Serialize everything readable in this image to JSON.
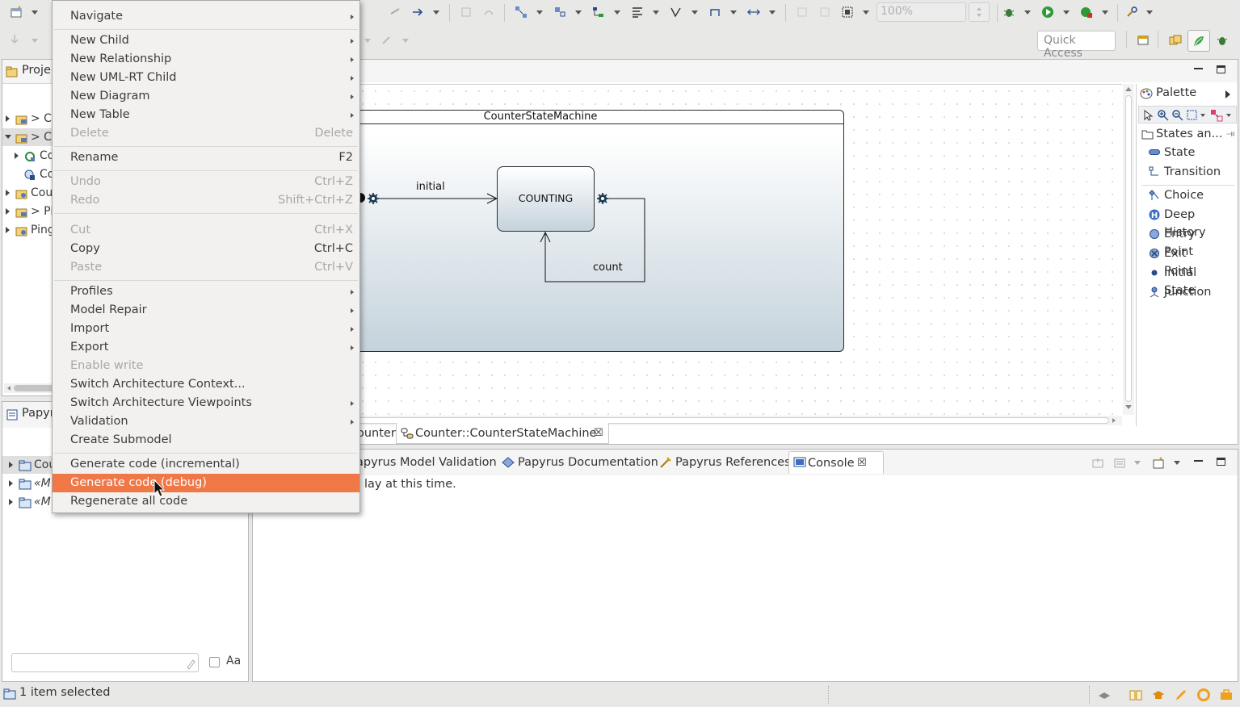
{
  "toolbar": {
    "zoom_value": "100%",
    "quick_access_placeholder": "Quick Access"
  },
  "project_explorer": {
    "title": "Projec",
    "rows": [
      {
        "label": "> Co",
        "expanded": false
      },
      {
        "label": "> Co",
        "expanded": true
      },
      {
        "label": "Co",
        "expanded": false
      },
      {
        "label": "Co",
        "expanded": false
      },
      {
        "label": "Cou",
        "expanded": false
      },
      {
        "label": "> Pi",
        "expanded": false
      },
      {
        "label": "Ping",
        "expanded": false
      }
    ]
  },
  "model_explorer": {
    "title": "Papyru",
    "rows": [
      {
        "label": "Cou"
      },
      {
        "label": "«M"
      },
      {
        "label": "«M"
      }
    ],
    "filter_placeholder": "",
    "case_label": "Aa"
  },
  "diagram": {
    "state_machine_label": "CounterStateMachine",
    "state_label": "COUNTING",
    "initial_transition_label": "initial",
    "loop_transition_label": "count"
  },
  "editor_tabs": [
    {
      "label": "ounter"
    },
    {
      "label": "Counter::CounterStateMachine"
    }
  ],
  "palette": {
    "title": "Palette",
    "drawer_label": "States an...",
    "items": [
      {
        "label": "State",
        "icon": "state-icon"
      },
      {
        "label": "Transition",
        "icon": "transition-icon"
      },
      {
        "label": "Choice",
        "icon": "choice-icon"
      },
      {
        "label": "Deep History",
        "icon": "deep-history-icon"
      },
      {
        "label": "Entry Point",
        "icon": "entry-point-icon"
      },
      {
        "label": "Exit Point",
        "icon": "exit-point-icon"
      },
      {
        "label": "Initial State",
        "icon": "initial-state-icon"
      },
      {
        "label": "Junction",
        "icon": "junction-icon"
      }
    ]
  },
  "bottom_tabs": [
    {
      "label": "apyrus Model Validation"
    },
    {
      "label": "Papyrus Documentation"
    },
    {
      "label": "Papyrus References"
    },
    {
      "label": "Console"
    }
  ],
  "console_message": "lay at this time.",
  "status_bar": {
    "text": "1 item selected"
  },
  "context_menu": {
    "items": [
      {
        "label": "Navigate",
        "shortcut": "",
        "submenu": true,
        "disabled": false
      },
      {
        "label": "New Child",
        "shortcut": "",
        "submenu": true,
        "disabled": false
      },
      {
        "label": "New Relationship",
        "shortcut": "",
        "submenu": true,
        "disabled": false
      },
      {
        "label": "New UML-RT Child",
        "shortcut": "",
        "submenu": true,
        "disabled": false
      },
      {
        "label": "New Diagram",
        "shortcut": "",
        "submenu": true,
        "disabled": false
      },
      {
        "label": "New Table",
        "shortcut": "",
        "submenu": true,
        "disabled": false
      },
      {
        "label": "Delete",
        "shortcut": "Delete",
        "submenu": false,
        "disabled": true
      },
      {
        "label": "Rename",
        "shortcut": "F2",
        "submenu": false,
        "disabled": false
      },
      {
        "label": "Undo",
        "shortcut": "Ctrl+Z",
        "submenu": false,
        "disabled": true
      },
      {
        "label": "Redo",
        "shortcut": "Shift+Ctrl+Z",
        "submenu": false,
        "disabled": true
      },
      {
        "label": "Cut",
        "shortcut": "Ctrl+X",
        "submenu": false,
        "disabled": true
      },
      {
        "label": "Copy",
        "shortcut": "Ctrl+C",
        "submenu": false,
        "disabled": false
      },
      {
        "label": "Paste",
        "shortcut": "Ctrl+V",
        "submenu": false,
        "disabled": true
      },
      {
        "label": "Profiles",
        "shortcut": "",
        "submenu": true,
        "disabled": false
      },
      {
        "label": "Model Repair",
        "shortcut": "",
        "submenu": true,
        "disabled": false
      },
      {
        "label": "Import",
        "shortcut": "",
        "submenu": true,
        "disabled": false
      },
      {
        "label": "Export",
        "shortcut": "",
        "submenu": true,
        "disabled": false
      },
      {
        "label": "Enable write",
        "shortcut": "",
        "submenu": false,
        "disabled": true
      },
      {
        "label": "Switch Architecture Context...",
        "shortcut": "",
        "submenu": false,
        "disabled": false
      },
      {
        "label": "Switch Architecture Viewpoints",
        "shortcut": "",
        "submenu": true,
        "disabled": false
      },
      {
        "label": "Validation",
        "shortcut": "",
        "submenu": true,
        "disabled": false
      },
      {
        "label": "Create Submodel",
        "shortcut": "",
        "submenu": false,
        "disabled": false
      },
      {
        "label": "Generate code (incremental)",
        "shortcut": "",
        "submenu": false,
        "disabled": false
      },
      {
        "label": "Generate code (debug)",
        "shortcut": "",
        "submenu": false,
        "disabled": false,
        "highlighted": true
      },
      {
        "label": "Regenerate all code",
        "shortcut": "",
        "submenu": false,
        "disabled": false
      }
    ]
  },
  "colors": {
    "menu_highlight": "#f07746",
    "state_fill_top": "#ffffff",
    "state_fill_bottom": "#c5d3dc"
  }
}
